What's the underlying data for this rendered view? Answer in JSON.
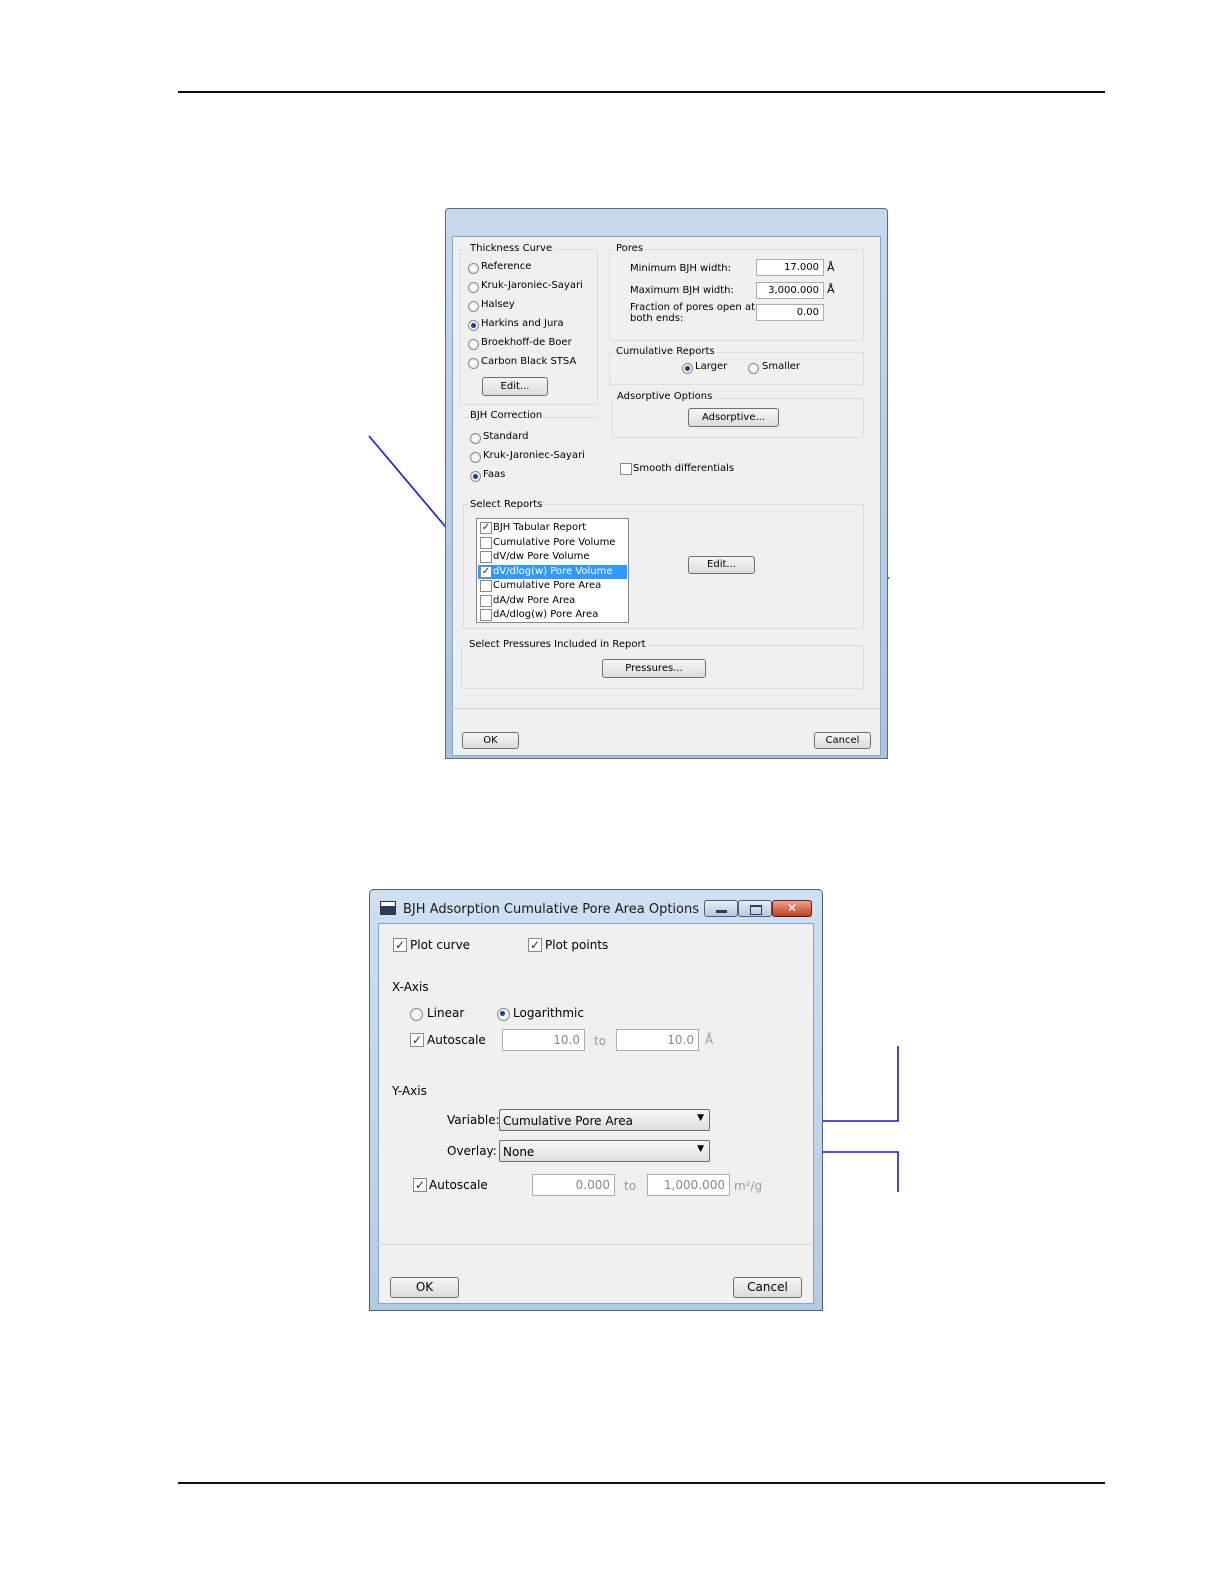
{
  "dialog1": {
    "thickness_curve": {
      "title": "Thickness Curve",
      "options": [
        "Reference",
        "Kruk-Jaroniec-Sayari",
        "Halsey",
        "Harkins and Jura",
        "Broekhoff-de Boer",
        "Carbon Black STSA"
      ],
      "selected": "Harkins and Jura",
      "edit_label": "Edit..."
    },
    "pores": {
      "title": "Pores",
      "min_label": "Minimum BJH width:",
      "min_value": "17.000",
      "max_label": "Maximum BJH width:",
      "max_value": "3,000.000",
      "unit": "Å",
      "fraction_label_1": "Fraction of pores open at",
      "fraction_label_2": "both ends:",
      "fraction_value": "0.00"
    },
    "cumulative_reports": {
      "title": "Cumulative Reports",
      "larger": "Larger",
      "smaller": "Smaller",
      "selected": "Larger"
    },
    "adsorptive_options": {
      "title": "Adsorptive Options",
      "button": "Adsorptive..."
    },
    "bjh_correction": {
      "title": "BJH Correction",
      "options": [
        "Standard",
        "Kruk-Jaroniec-Sayari",
        "Faas"
      ],
      "selected": "Faas"
    },
    "smooth_label": "Smooth differentials",
    "select_reports": {
      "title": "Select Reports",
      "items": [
        {
          "label": "BJH Tabular Report",
          "checked": true
        },
        {
          "label": "Cumulative Pore Volume",
          "checked": false
        },
        {
          "label": "dV/dw Pore Volume",
          "checked": false
        },
        {
          "label": "dV/dlog(w) Pore Volume",
          "checked": true
        },
        {
          "label": "Cumulative Pore Area",
          "checked": false
        },
        {
          "label": "dA/dw Pore Area",
          "checked": false
        },
        {
          "label": "dA/dlog(w) Pore Area",
          "checked": false
        }
      ],
      "selected_index": 3,
      "edit_label": "Edit..."
    },
    "pressures": {
      "title": "Select Pressures Included in Report",
      "button": "Pressures..."
    },
    "ok_label": "OK",
    "cancel_label": "Cancel"
  },
  "dialog2": {
    "title": "BJH Adsorption Cumulative Pore Area Options",
    "plot_curve": "Plot curve",
    "plot_points": "Plot points",
    "xaxis": {
      "title": "X-Axis",
      "linear": "Linear",
      "logarithmic": "Logarithmic",
      "selected": "Logarithmic",
      "autoscale": "Autoscale",
      "from": "10.0",
      "to_label": "to",
      "to": "10.0",
      "unit": "Å"
    },
    "yaxis": {
      "title": "Y-Axis",
      "variable_label": "Variable:",
      "variable_value": "Cumulative Pore Area",
      "overlay_label": "Overlay:",
      "overlay_value": "None",
      "autoscale": "Autoscale",
      "from": "0.000",
      "to_label": "to",
      "to": "1,000.000",
      "unit": "m²/g"
    },
    "ok_label": "OK",
    "cancel_label": "Cancel"
  },
  "colors": {
    "callout": "#1a1acc",
    "selection": "#3399ff"
  }
}
